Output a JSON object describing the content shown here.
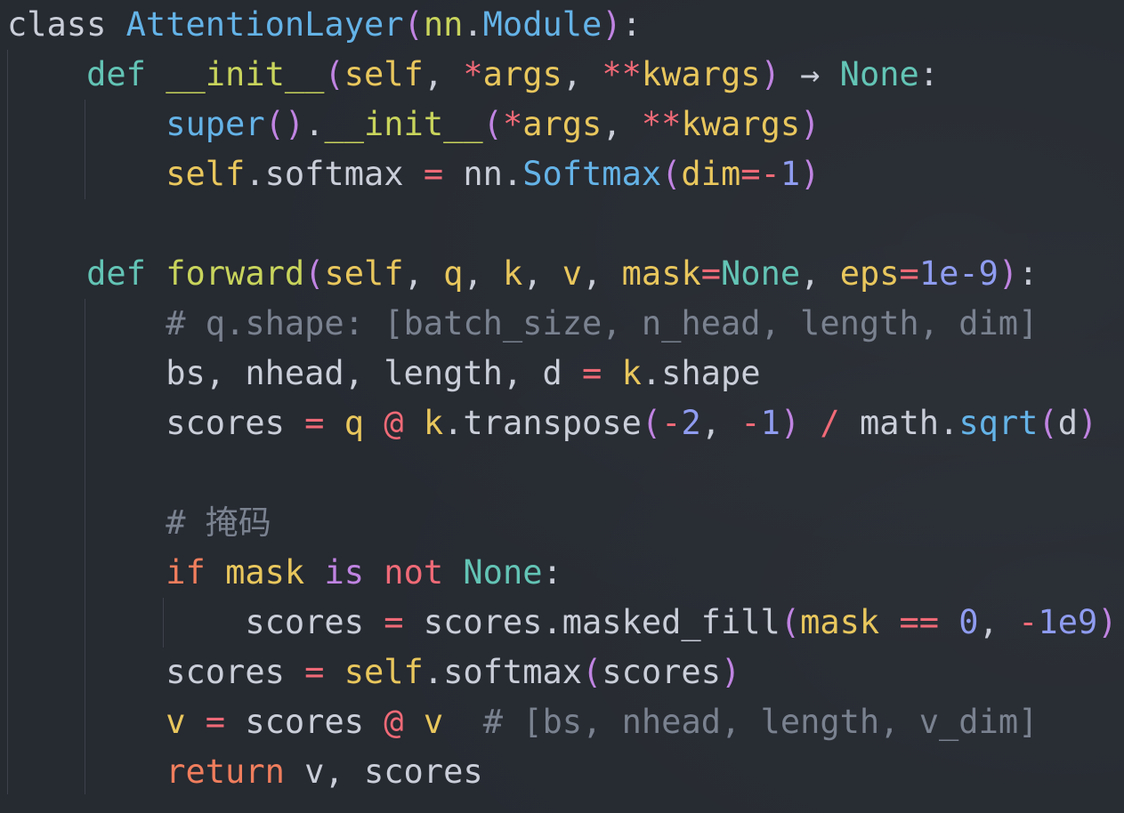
{
  "colors": {
    "background": "#262a31",
    "plain": "#c9ced8",
    "keyword": "#63c4b5",
    "class_name": "#64b3e7",
    "function": "#c8d45c",
    "paren": "#c084e2",
    "self_param": "#e9c75d",
    "operator": "#f06a77",
    "number": "#8f9cf0",
    "comment": "#7a8290",
    "control": "#f07e5d"
  },
  "lines": [
    {
      "tokens": [
        {
          "t": "class ",
          "k": "plain"
        },
        {
          "t": "AttentionLayer",
          "k": "cls"
        },
        {
          "t": "(",
          "k": "par"
        },
        {
          "t": "nn",
          "k": "fn"
        },
        {
          "t": ".",
          "k": "plain"
        },
        {
          "t": "Module",
          "k": "cls"
        },
        {
          "t": ")",
          "k": "par"
        },
        {
          "t": ":",
          "k": "plain"
        }
      ]
    },
    {
      "tokens": [
        {
          "t": "    ",
          "k": "plain"
        },
        {
          "t": "def",
          "k": "kw"
        },
        {
          "t": " ",
          "k": "plain"
        },
        {
          "t": "__init__",
          "k": "fn"
        },
        {
          "t": "(",
          "k": "par"
        },
        {
          "t": "self",
          "k": "self"
        },
        {
          "t": ", ",
          "k": "plain"
        },
        {
          "t": "*",
          "k": "op"
        },
        {
          "t": "args",
          "k": "arg"
        },
        {
          "t": ", ",
          "k": "plain"
        },
        {
          "t": "**",
          "k": "op"
        },
        {
          "t": "kwargs",
          "k": "arg"
        },
        {
          "t": ")",
          "k": "par"
        },
        {
          "t": " → ",
          "k": "plain"
        },
        {
          "t": "None",
          "k": "kw"
        },
        {
          "t": ":",
          "k": "plain"
        }
      ]
    },
    {
      "tokens": [
        {
          "t": "        ",
          "k": "plain"
        },
        {
          "t": "super",
          "k": "cls"
        },
        {
          "t": "()",
          "k": "par"
        },
        {
          "t": ".",
          "k": "plain"
        },
        {
          "t": "__init__",
          "k": "fn"
        },
        {
          "t": "(",
          "k": "par"
        },
        {
          "t": "*",
          "k": "op"
        },
        {
          "t": "args",
          "k": "arg"
        },
        {
          "t": ", ",
          "k": "plain"
        },
        {
          "t": "**",
          "k": "op"
        },
        {
          "t": "kwargs",
          "k": "arg"
        },
        {
          "t": ")",
          "k": "par"
        }
      ]
    },
    {
      "tokens": [
        {
          "t": "        ",
          "k": "plain"
        },
        {
          "t": "self",
          "k": "self"
        },
        {
          "t": ".softmax ",
          "k": "plain"
        },
        {
          "t": "=",
          "k": "op"
        },
        {
          "t": " nn.",
          "k": "plain"
        },
        {
          "t": "Softmax",
          "k": "cls"
        },
        {
          "t": "(",
          "k": "par"
        },
        {
          "t": "dim",
          "k": "arg"
        },
        {
          "t": "=-",
          "k": "op"
        },
        {
          "t": "1",
          "k": "num"
        },
        {
          "t": ")",
          "k": "par"
        }
      ]
    },
    {
      "tokens": []
    },
    {
      "tokens": [
        {
          "t": "    ",
          "k": "plain"
        },
        {
          "t": "def",
          "k": "kw"
        },
        {
          "t": " ",
          "k": "plain"
        },
        {
          "t": "forward",
          "k": "fn"
        },
        {
          "t": "(",
          "k": "par"
        },
        {
          "t": "self",
          "k": "self"
        },
        {
          "t": ", ",
          "k": "plain"
        },
        {
          "t": "q",
          "k": "arg"
        },
        {
          "t": ", ",
          "k": "plain"
        },
        {
          "t": "k",
          "k": "arg"
        },
        {
          "t": ", ",
          "k": "plain"
        },
        {
          "t": "v",
          "k": "arg"
        },
        {
          "t": ", ",
          "k": "plain"
        },
        {
          "t": "mask",
          "k": "arg"
        },
        {
          "t": "=",
          "k": "op"
        },
        {
          "t": "None",
          "k": "kw"
        },
        {
          "t": ", ",
          "k": "plain"
        },
        {
          "t": "eps",
          "k": "arg"
        },
        {
          "t": "=",
          "k": "op"
        },
        {
          "t": "1e-9",
          "k": "num"
        },
        {
          "t": ")",
          "k": "par"
        },
        {
          "t": ":",
          "k": "plain"
        }
      ]
    },
    {
      "tokens": [
        {
          "t": "        ",
          "k": "plain"
        },
        {
          "t": "# q.shape: [batch_size, n_head, length, dim]",
          "k": "com"
        }
      ]
    },
    {
      "tokens": [
        {
          "t": "        ",
          "k": "plain"
        },
        {
          "t": "bs, nhead, length, d ",
          "k": "plain"
        },
        {
          "t": "=",
          "k": "op"
        },
        {
          "t": " ",
          "k": "plain"
        },
        {
          "t": "k",
          "k": "arg"
        },
        {
          "t": ".shape",
          "k": "plain"
        }
      ]
    },
    {
      "tokens": [
        {
          "t": "        ",
          "k": "plain"
        },
        {
          "t": "scores ",
          "k": "plain"
        },
        {
          "t": "=",
          "k": "op"
        },
        {
          "t": " ",
          "k": "plain"
        },
        {
          "t": "q",
          "k": "arg"
        },
        {
          "t": " ",
          "k": "plain"
        },
        {
          "t": "@",
          "k": "op"
        },
        {
          "t": " ",
          "k": "plain"
        },
        {
          "t": "k",
          "k": "arg"
        },
        {
          "t": ".transpose",
          "k": "plain"
        },
        {
          "t": "(",
          "k": "par"
        },
        {
          "t": "-",
          "k": "op"
        },
        {
          "t": "2",
          "k": "num"
        },
        {
          "t": ", ",
          "k": "plain"
        },
        {
          "t": "-",
          "k": "op"
        },
        {
          "t": "1",
          "k": "num"
        },
        {
          "t": ")",
          "k": "par"
        },
        {
          "t": " ",
          "k": "plain"
        },
        {
          "t": "/",
          "k": "op"
        },
        {
          "t": " math.",
          "k": "plain"
        },
        {
          "t": "sqrt",
          "k": "cls"
        },
        {
          "t": "(",
          "k": "par"
        },
        {
          "t": "d",
          "k": "plain"
        },
        {
          "t": ")",
          "k": "par"
        }
      ]
    },
    {
      "tokens": []
    },
    {
      "tokens": [
        {
          "t": "        ",
          "k": "plain"
        },
        {
          "t": "# 掩码",
          "k": "com"
        }
      ]
    },
    {
      "tokens": [
        {
          "t": "        ",
          "k": "plain"
        },
        {
          "t": "if",
          "k": "ctrl"
        },
        {
          "t": " ",
          "k": "plain"
        },
        {
          "t": "mask",
          "k": "arg"
        },
        {
          "t": " ",
          "k": "plain"
        },
        {
          "t": "is",
          "k": "par"
        },
        {
          "t": " ",
          "k": "plain"
        },
        {
          "t": "not",
          "k": "op"
        },
        {
          "t": " ",
          "k": "plain"
        },
        {
          "t": "None",
          "k": "kw"
        },
        {
          "t": ":",
          "k": "plain"
        }
      ]
    },
    {
      "tokens": [
        {
          "t": "            ",
          "k": "plain"
        },
        {
          "t": "scores ",
          "k": "plain"
        },
        {
          "t": "=",
          "k": "op"
        },
        {
          "t": " scores.masked_fill",
          "k": "plain"
        },
        {
          "t": "(",
          "k": "par"
        },
        {
          "t": "mask",
          "k": "arg"
        },
        {
          "t": " ",
          "k": "plain"
        },
        {
          "t": "==",
          "k": "op"
        },
        {
          "t": " ",
          "k": "plain"
        },
        {
          "t": "0",
          "k": "num"
        },
        {
          "t": ", ",
          "k": "plain"
        },
        {
          "t": "-",
          "k": "op"
        },
        {
          "t": "1e9",
          "k": "num"
        },
        {
          "t": ")",
          "k": "par"
        }
      ]
    },
    {
      "tokens": [
        {
          "t": "        ",
          "k": "plain"
        },
        {
          "t": "scores ",
          "k": "plain"
        },
        {
          "t": "=",
          "k": "op"
        },
        {
          "t": " ",
          "k": "plain"
        },
        {
          "t": "self",
          "k": "self"
        },
        {
          "t": ".softmax",
          "k": "plain"
        },
        {
          "t": "(",
          "k": "par"
        },
        {
          "t": "scores",
          "k": "plain"
        },
        {
          "t": ")",
          "k": "par"
        }
      ]
    },
    {
      "tokens": [
        {
          "t": "        ",
          "k": "plain"
        },
        {
          "t": "v",
          "k": "arg"
        },
        {
          "t": " ",
          "k": "plain"
        },
        {
          "t": "=",
          "k": "op"
        },
        {
          "t": " scores ",
          "k": "plain"
        },
        {
          "t": "@",
          "k": "op"
        },
        {
          "t": " ",
          "k": "plain"
        },
        {
          "t": "v",
          "k": "arg"
        },
        {
          "t": "  ",
          "k": "plain"
        },
        {
          "t": "# [bs, nhead, length, v_dim]",
          "k": "com"
        }
      ]
    },
    {
      "tokens": [
        {
          "t": "        ",
          "k": "plain"
        },
        {
          "t": "return",
          "k": "ctrl"
        },
        {
          "t": " v, scores",
          "k": "plain"
        }
      ]
    }
  ]
}
